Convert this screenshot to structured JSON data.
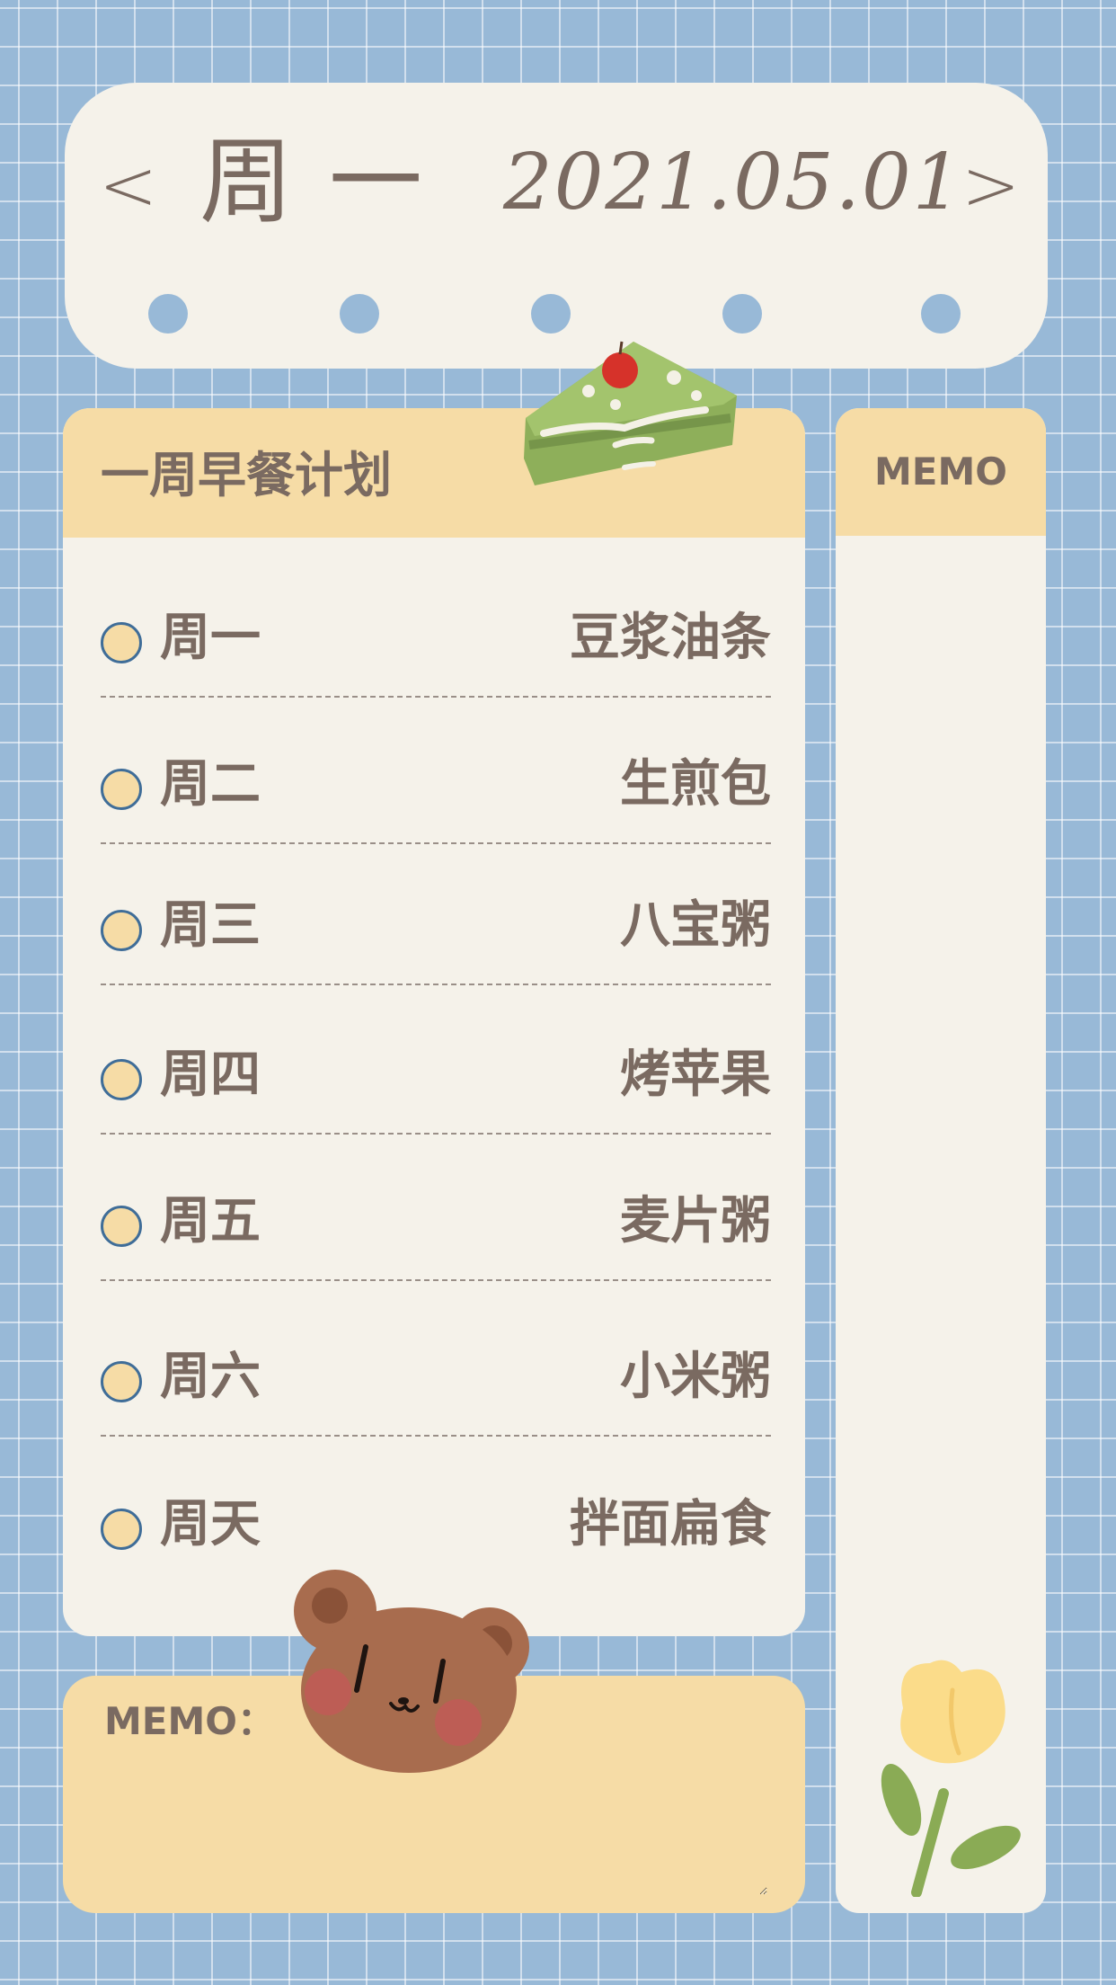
{
  "header": {
    "prev_label": "<",
    "next_label": ">",
    "weekday": "周一",
    "date": "2021.05.01"
  },
  "plan": {
    "title": "一周早餐计划",
    "items": [
      {
        "day": "周一",
        "food": "豆浆油条"
      },
      {
        "day": "周二",
        "food": "生煎包"
      },
      {
        "day": "周三",
        "food": "八宝粥"
      },
      {
        "day": "周四",
        "food": "烤苹果"
      },
      {
        "day": "周五",
        "food": "麦片粥"
      },
      {
        "day": "周六",
        "food": "小米粥"
      },
      {
        "day": "周天",
        "food": "拌面扁食"
      }
    ]
  },
  "side_memo": {
    "title": "MEMO"
  },
  "bottom_memo": {
    "title": "MEMO："
  },
  "colors": {
    "background": "#98b9d7",
    "panel": "#f5f2ea",
    "accent": "#f6dca6",
    "text": "#7a6a61",
    "ring": "#3f6d98"
  },
  "icons": [
    "chevron-left-icon",
    "chevron-right-icon",
    "cake-sticker",
    "bear-sticker",
    "tulip-sticker"
  ]
}
